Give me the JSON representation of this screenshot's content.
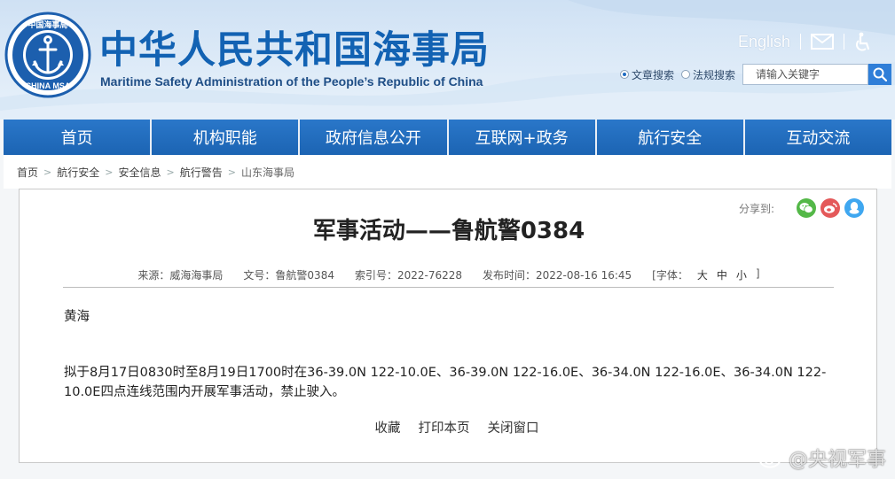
{
  "header": {
    "site_title": "中华人民共和国海事局",
    "site_subtitle": "Maritime Safety Administration of the People’s Republic of China",
    "logo": {
      "ring_text_top": "中国海事局",
      "ring_text_bottom": "CHINA MSA",
      "icon": "anchor-emblem-icon"
    },
    "english_link": "English",
    "mail_icon": "mail-icon",
    "accessibility_icon": "wheelchair-icon",
    "colors": {
      "title": "#1262b3",
      "nav": "#1f68b8",
      "search_button": "#2f7ed8"
    }
  },
  "search": {
    "option_article": "文章搜索",
    "option_law": "法规搜索",
    "selected": "文章搜索",
    "placeholder": "请输入关键字",
    "button_icon": "search-icon"
  },
  "nav": {
    "items": [
      {
        "label": "首页"
      },
      {
        "label": "机构职能"
      },
      {
        "label": "政府信息公开"
      },
      {
        "label": "互联网+政务"
      },
      {
        "label": "航行安全"
      },
      {
        "label": "互动交流"
      }
    ]
  },
  "breadcrumb": {
    "items": [
      {
        "label": "首页"
      },
      {
        "label": "航行安全"
      },
      {
        "label": "安全信息"
      },
      {
        "label": "航行警告"
      },
      {
        "label": "山东海事局"
      }
    ],
    "separator": ">"
  },
  "article": {
    "share_label": "分享到:",
    "share_icons": [
      "wechat-icon",
      "weibo-icon",
      "qq-icon"
    ],
    "title": "军事活动——鲁航警0384",
    "meta": {
      "source": "来源：威海海事局",
      "doc_no": "文号：鲁航警0384",
      "index_no": "索引号：2022-76228",
      "published": "发布时间：2022-08-16 16:45",
      "font_label_open": "[字体：",
      "font_large": "大",
      "font_medium": "中",
      "font_small": "小",
      "font_label_close": "]"
    },
    "paragraph1": "黄海",
    "paragraph2": "拟于8月17日0830时至8月19日1700时在36-39.0N 122-10.0E、36-39.0N 122-16.0E、36-34.0N 122-16.0E、36-34.0N 122-10.0E四点连线范围内开展军事活动，禁止驶入。",
    "actions": {
      "favorite": "收藏",
      "print": "打印本页",
      "close": "关闭窗口"
    }
  },
  "watermark": {
    "text": "@央视军事",
    "icon": "weibo-logo-icon"
  }
}
